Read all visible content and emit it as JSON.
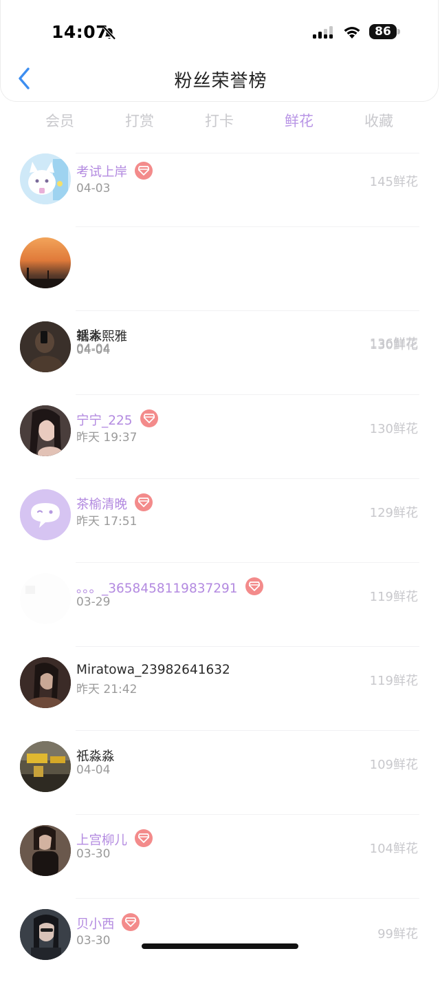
{
  "status": {
    "time": "14:07",
    "battery": "86"
  },
  "header": {
    "title": "粉丝荣誉榜"
  },
  "tabs": [
    {
      "label": "会员",
      "active": false
    },
    {
      "label": "打赏",
      "active": false
    },
    {
      "label": "打卡",
      "active": false
    },
    {
      "label": "鲜花",
      "active": true
    },
    {
      "label": "收藏",
      "active": false
    }
  ],
  "fans": [
    {
      "name": "考试上岸",
      "date": "04-03",
      "count": "145鲜花",
      "vip": true
    },
    {
      "name": "祇淼",
      "date": "04-04",
      "count": "136鲜花",
      "vip": false
    },
    {
      "name": "端木熙雅",
      "date": "04-04",
      "count": "130鲜花",
      "vip": false
    },
    {
      "name": "宁宁_225",
      "date": "昨天 19:37",
      "count": "130鲜花",
      "vip": true
    },
    {
      "name": "茶榆清晚",
      "date": "昨天 17:51",
      "count": "129鲜花",
      "vip": true
    },
    {
      "name": "。。。_3658458119837291",
      "date": "03-29",
      "count": "119鲜花",
      "vip": true
    },
    {
      "name": "Miratowa_23982641632",
      "date": "昨天 21:42",
      "count": "119鲜花",
      "vip": false
    },
    {
      "name": "祇淼淼",
      "date": "04-04",
      "count": "109鲜花",
      "vip": false
    },
    {
      "name": "上宫柳儿",
      "date": "03-30",
      "count": "104鲜花",
      "vip": true
    },
    {
      "name": "贝小西",
      "date": "03-30",
      "count": "99鲜花",
      "vip": true
    }
  ],
  "colors": {
    "accent": "#b996e6",
    "vip_name": "#b38ae0",
    "badge": "#f38b8b",
    "back_arrow": "#3d8ef0"
  }
}
